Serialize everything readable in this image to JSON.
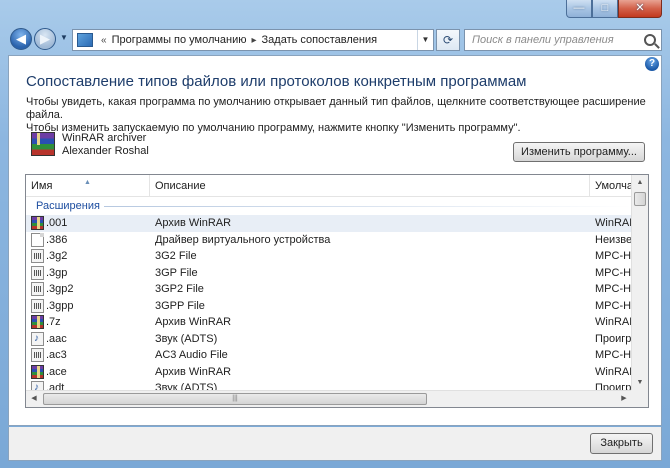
{
  "window": {
    "caption_buttons": {
      "minimize": "—",
      "maximize": "□",
      "close": "✕"
    }
  },
  "nav": {
    "back_icon": "arrow-left-icon",
    "forward_icon": "arrow-right-icon",
    "breadcrumb": [
      "Программы по умолчанию",
      "Задать сопоставления"
    ],
    "search_placeholder": "Поиск в панели управления"
  },
  "header": {
    "title": "Сопоставление типов файлов или протоколов конкретным программам",
    "description_line1": "Чтобы увидеть, какая программа по умолчанию открывает данный тип файлов, щелкните соответствующее расширение файла.",
    "description_line2": "Чтобы изменить запускаемую по умолчанию программу, нажмите кнопку \"Изменить программу\"."
  },
  "program": {
    "name": "WinRAR archiver",
    "vendor": "Alexander Roshal",
    "change_button": "Изменить программу..."
  },
  "list": {
    "columns": [
      "Имя",
      "Описание",
      "Умолча"
    ],
    "group": "Расширения",
    "rows": [
      {
        "ext": ".001",
        "desc": "Архив WinRAR",
        "default": "WinRAR",
        "icon": "rar",
        "selected": true
      },
      {
        "ext": ".386",
        "desc": "Драйвер виртуального устройства",
        "default": "Неизвес",
        "icon": "doc"
      },
      {
        "ext": ".3g2",
        "desc": "3G2 File",
        "default": "MPC-HC",
        "icon": "media"
      },
      {
        "ext": ".3gp",
        "desc": "3GP File",
        "default": "MPC-HC",
        "icon": "media"
      },
      {
        "ext": ".3gp2",
        "desc": "3GP2 File",
        "default": "MPC-HC",
        "icon": "media"
      },
      {
        "ext": ".3gpp",
        "desc": "3GPP File",
        "default": "MPC-HC",
        "icon": "media"
      },
      {
        "ext": ".7z",
        "desc": "Архив WinRAR",
        "default": "WinRAR",
        "icon": "rar"
      },
      {
        "ext": ".aac",
        "desc": "Звук (ADTS)",
        "default": "Проигр",
        "icon": "audio"
      },
      {
        "ext": ".ac3",
        "desc": "AC3 Audio File",
        "default": "MPC-HC",
        "icon": "media"
      },
      {
        "ext": ".ace",
        "desc": "Архив WinRAR",
        "default": "WinRAR",
        "icon": "rar"
      },
      {
        "ext": ".adt",
        "desc": "Звук (ADTS)",
        "default": "Проигр",
        "icon": "audio"
      }
    ]
  },
  "footer": {
    "close_button": "Закрыть"
  }
}
